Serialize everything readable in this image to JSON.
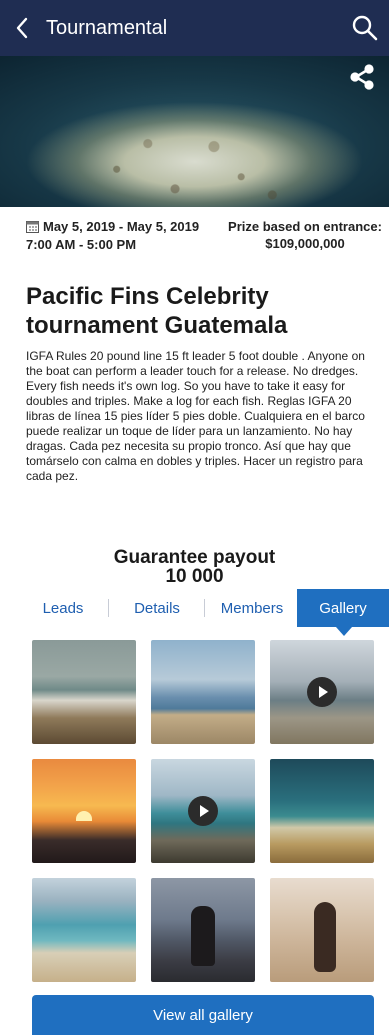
{
  "header": {
    "back_icon": "chevron-left-icon",
    "title": "Tournamental",
    "search_icon": "search-icon"
  },
  "hero": {
    "share_icon": "share-icon"
  },
  "event": {
    "date_range": "May 5, 2019 - May 5, 2019",
    "time_range": "7:00 AM - 5:00 PM",
    "prize_label": "Prize based on entrance:",
    "prize_value": "$109,000,000",
    "title": "Pacific Fins Celebrity tournament Guatemala",
    "description": "IGFA Rules 20 pound line 15 ft leader 5 foot double . Anyone on the boat can perform a leader touch for a release. No dredges. Every fish needs it's own log. So you have to take it easy for doubles and triples. Make a log for each fish. Reglas IGFA 20 libras de línea 15 pies líder 5 pies doble. Cualquiera en el barco puede realizar un toque de líder para un lanzamiento. No hay dragas. Cada pez necesita su propio tronco. Así que hay que tomárselo con calma en dobles y triples. Hacer un registro para cada pez."
  },
  "payout": {
    "label": "Guarantee payout",
    "amount": "10 000"
  },
  "tabs": [
    {
      "label": "Leads",
      "active": false
    },
    {
      "label": "Details",
      "active": false
    },
    {
      "label": "Members",
      "active": false
    },
    {
      "label": "Gallery",
      "active": true
    }
  ],
  "gallery": {
    "items": [
      {
        "type": "photo"
      },
      {
        "type": "photo"
      },
      {
        "type": "video"
      },
      {
        "type": "photo"
      },
      {
        "type": "video"
      },
      {
        "type": "photo"
      },
      {
        "type": "photo"
      },
      {
        "type": "photo"
      },
      {
        "type": "photo"
      }
    ],
    "view_all_label": "View all gallery"
  },
  "colors": {
    "header_bg": "#1f2d52",
    "accent": "#1f6fc0",
    "tab_text": "#1f5fb0"
  }
}
